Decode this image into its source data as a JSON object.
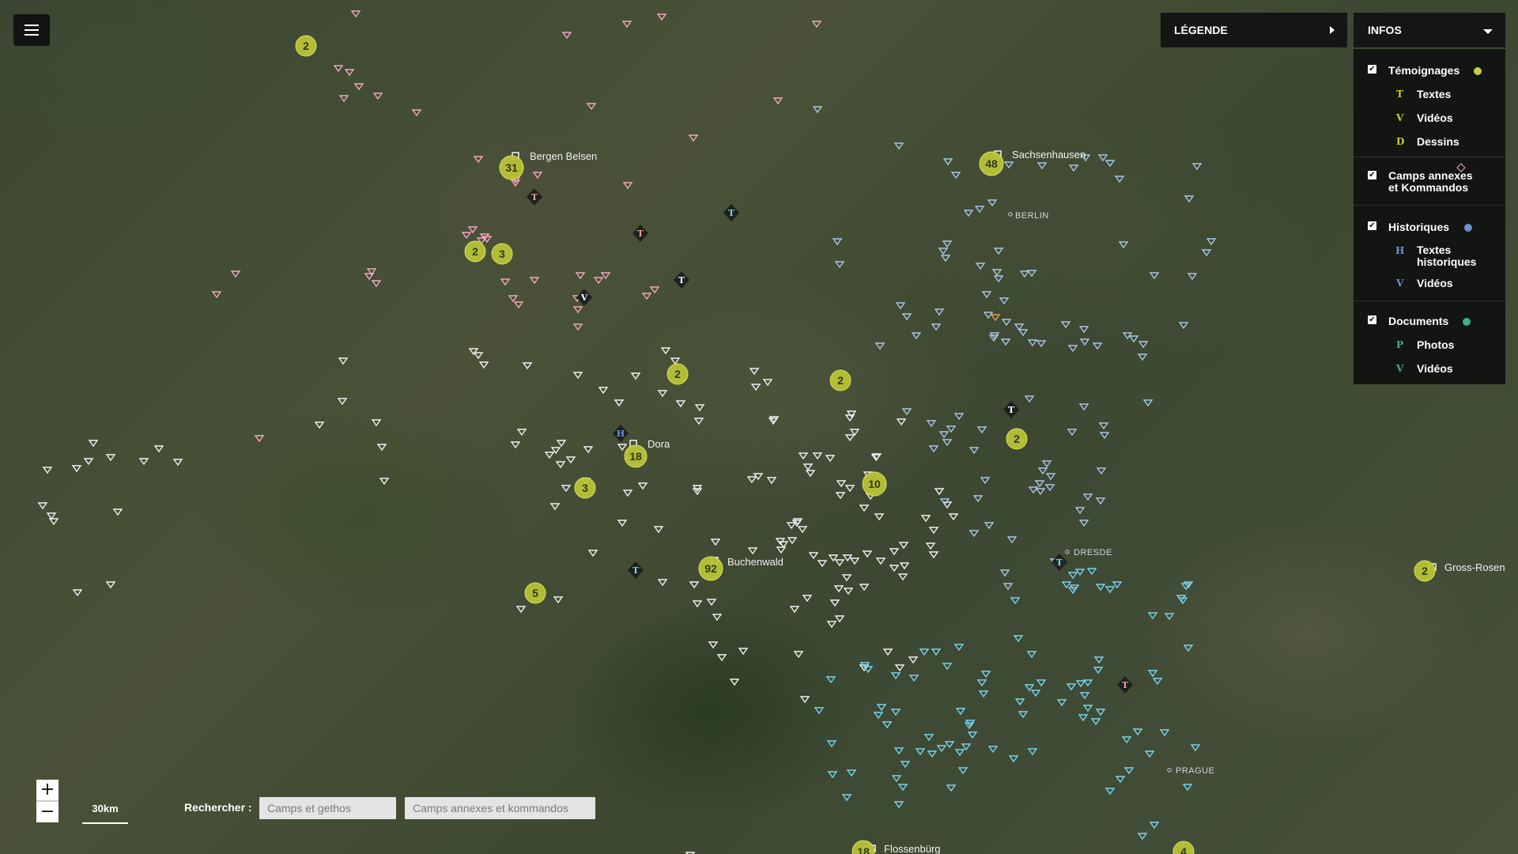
{
  "menu": {
    "icon": "hamburger-icon"
  },
  "legend": {
    "title": "LÉGENDE",
    "icon": "caret-right-icon"
  },
  "infos": {
    "title": "INFOS",
    "icon": "caret-down-icon",
    "groups": [
      {
        "label": "Témoignages",
        "checked": true,
        "color": "#c9cc3c",
        "items": [
          {
            "symbol": "T",
            "label": "Textes",
            "color": "#c9cc3c"
          },
          {
            "symbol": "V",
            "label": "Vidéos",
            "color": "#c9cc3c"
          },
          {
            "symbol": "D",
            "label": "Dessins",
            "color": "#c9cc3c"
          }
        ]
      },
      {
        "label_lines": [
          "Camps annexes",
          "et Kommandos"
        ],
        "checked": true,
        "marker_icon": "diamond-outline-icon",
        "marker_color": "#d89ab4"
      },
      {
        "label": "Historiques",
        "checked": true,
        "color": "#6f8fd8",
        "items": [
          {
            "symbol": "H",
            "label_lines": [
              "Textes",
              "historiques"
            ],
            "color": "#6f8fd8"
          },
          {
            "symbol": "V",
            "label": "Vidéos",
            "color": "#6f8fd8"
          }
        ]
      },
      {
        "label": "Documents",
        "checked": true,
        "color": "#3eb08a",
        "items": [
          {
            "symbol": "P",
            "label": "Photos",
            "color": "#3eb08a"
          },
          {
            "symbol": "V",
            "label": "Vidéos",
            "color": "#3eb08a"
          }
        ]
      }
    ]
  },
  "map": {
    "camps": [
      "Bergen Belsen",
      "Sachsenhausen",
      "Dora",
      "Buchenwald",
      "Gross-Rosen",
      "Flossenbürg"
    ],
    "cities": [
      "BERLIN",
      "DRESDE",
      "PRAGUE"
    ],
    "clusters": [
      "2",
      "31",
      "48",
      "2",
      "3",
      "2",
      "2",
      "18",
      "3",
      "2",
      "10",
      "92",
      "5",
      "2",
      "18",
      "4"
    ],
    "colors": {
      "cluster": "#b9c237",
      "cluster_text": "#2f3a1c",
      "marker_pink": "#f2a8bf",
      "marker_cyan": "#79d4ee",
      "marker_white": "#f0f0f0",
      "marker_orange": "#e2a24b",
      "marker_lightblue": "#a9c6e4",
      "pin_bg": "#1a1c1b",
      "pin_letter_red": "#f09aa2",
      "pin_letter_cyan": "#7ad1e6",
      "pin_letter_white": "#ffffff",
      "pin_letter_blue": "#6f8fd8"
    },
    "pins": [
      "T",
      "T",
      "T",
      "T",
      "V",
      "T",
      "T",
      "T",
      "T",
      "H"
    ]
  },
  "controls": {
    "zoom_in_label": "+",
    "zoom_out_label": "−",
    "scale_label": "30km",
    "search_label": "Rechercher :",
    "search_camps_placeholder": "Camps et gethos",
    "search_annexes_placeholder": "Camps annexes et kommandos"
  }
}
